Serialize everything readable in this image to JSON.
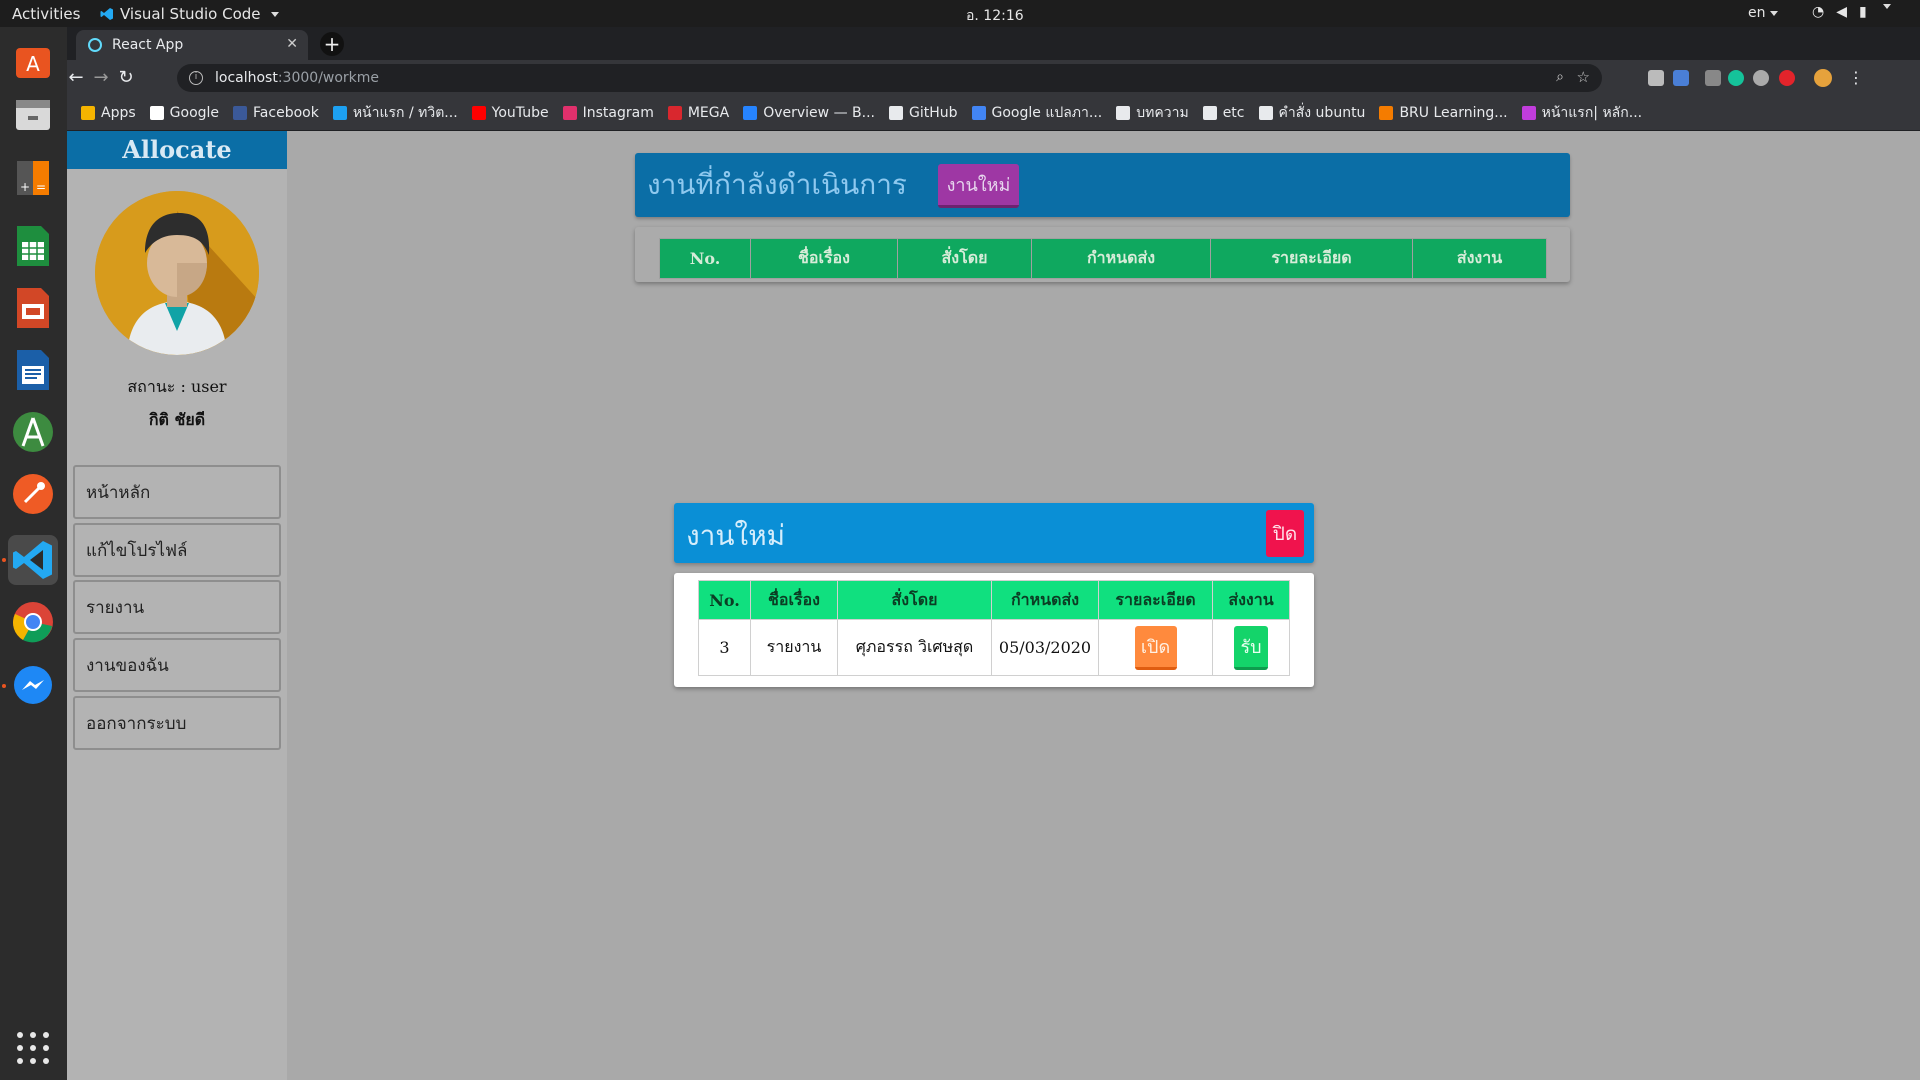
{
  "os_topbar": {
    "activities": "Activities",
    "app_name": "Visual Studio Code",
    "clock": "อ. 12:16",
    "lang": "en"
  },
  "dock": {
    "items": [
      "software-center",
      "files",
      "calculator",
      "spreadsheet",
      "presentation",
      "writer",
      "android-studio",
      "postman",
      "vscode",
      "chrome",
      "messenger"
    ]
  },
  "browser": {
    "tab_title": "React App",
    "url_host": "localhost",
    "url_path": ":3000/workme",
    "bookmarks": [
      {
        "label": "Apps",
        "color": "#f5b400"
      },
      {
        "label": "Google",
        "color": "#ffffff"
      },
      {
        "label": "Facebook",
        "color": "#3b5998"
      },
      {
        "label": "หน้าแรก / ทวิต...",
        "color": "#1da1f2"
      },
      {
        "label": "YouTube",
        "color": "#ff0000"
      },
      {
        "label": "Instagram",
        "color": "#e1306c"
      },
      {
        "label": "MEGA",
        "color": "#d9272e"
      },
      {
        "label": "Overview — B...",
        "color": "#2684ff"
      },
      {
        "label": "GitHub",
        "color": "#e8eaed"
      },
      {
        "label": "Google แปลภา...",
        "color": "#4285f4"
      },
      {
        "label": "บทความ",
        "color": "#e8eaed"
      },
      {
        "label": "etc",
        "color": "#e8eaed"
      },
      {
        "label": "คำสั่ง ubuntu",
        "color": "#e8eaed"
      },
      {
        "label": "BRU Learning...",
        "color": "#f57c00"
      },
      {
        "label": "หน้าแรก| หลัก...",
        "color": "#c13ddc"
      }
    ]
  },
  "app": {
    "brand": "Allocate",
    "status": "สถานะ : user",
    "user_name": "กิติ ชัยดี",
    "menu": [
      "หน้าหลัก",
      "แก้ไขโปรไฟล์",
      "รายงาน",
      "งานของฉัน",
      "ออกจากระบบ"
    ]
  },
  "progress_panel": {
    "title": "งานที่กำลังดำเนินการ",
    "new_button": "งานใหม่",
    "columns": [
      "No.",
      "ชื่อเรื่อง",
      "สั่งโดย",
      "กำหนดส่ง",
      "รายละเอียด",
      "ส่งงาน"
    ]
  },
  "new_tasks_modal": {
    "title": "งานใหม่",
    "close_button": "ปิด",
    "columns": [
      "No.",
      "ชื่อเรื่อง",
      "สั่งโดย",
      "กำหนดส่ง",
      "รายละเอียด",
      "ส่งงาน"
    ],
    "rows": [
      {
        "no": "3",
        "subject": "รายงาน",
        "assigned_by": "ศุภอรรถ วิเศษสุด",
        "due": "05/03/2020",
        "detail_button": "เปิด",
        "accept_button": "รับ"
      }
    ]
  }
}
